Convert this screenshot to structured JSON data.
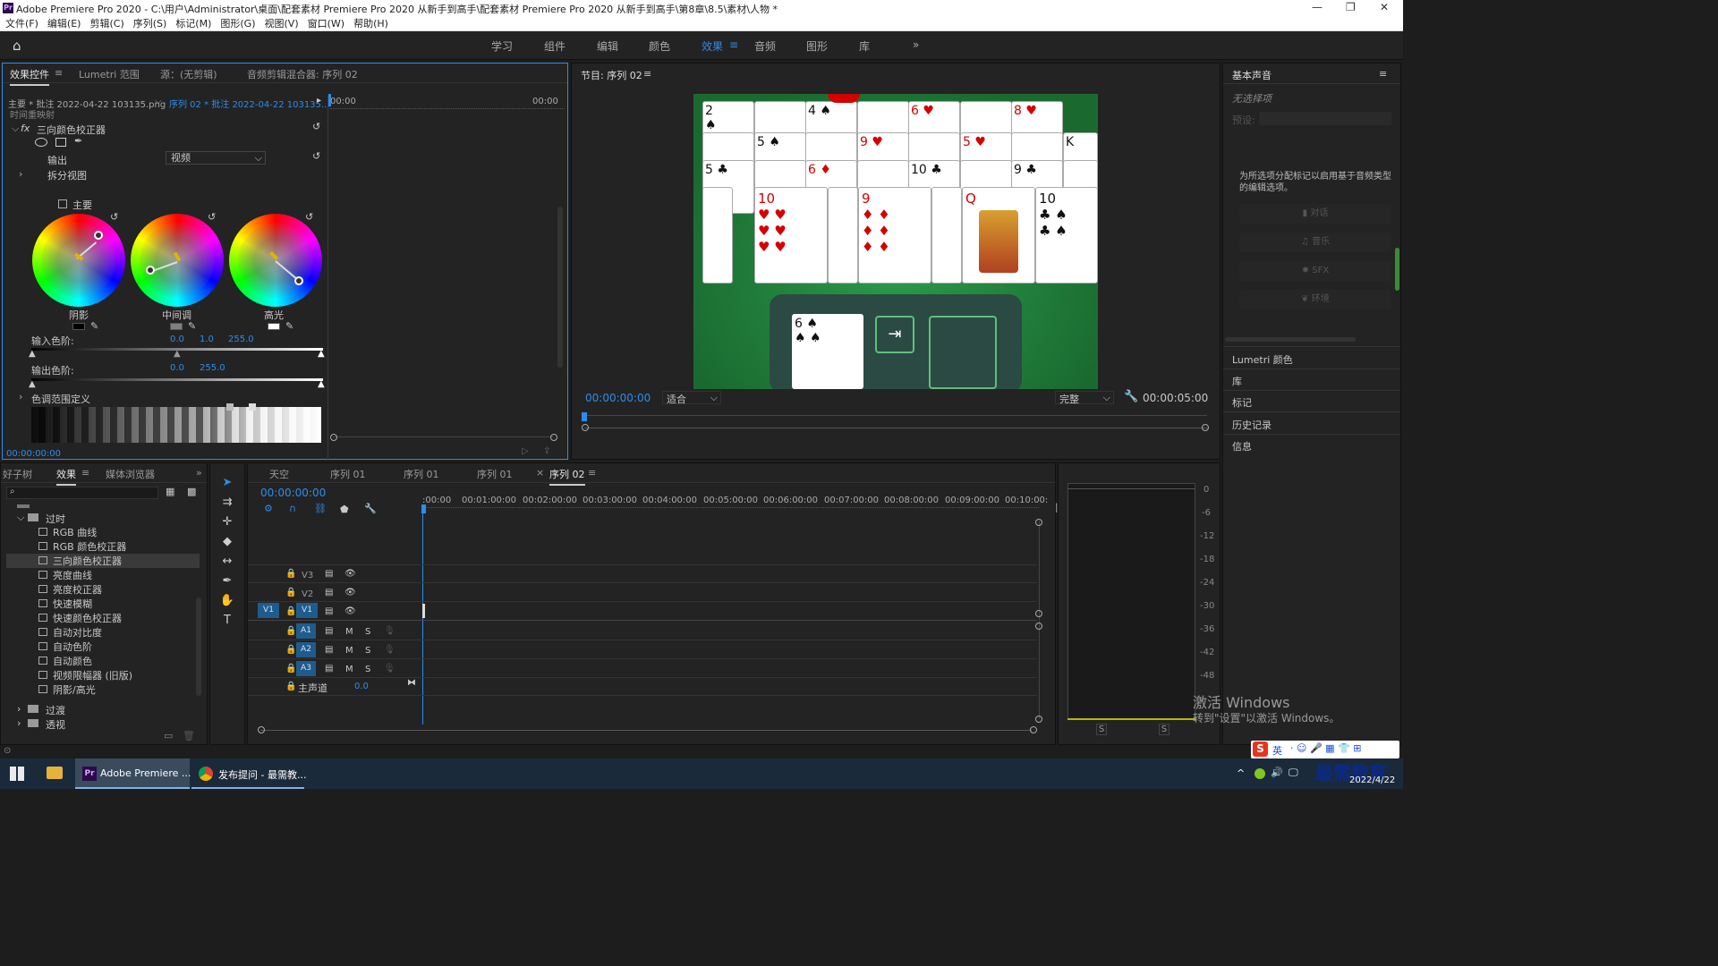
{
  "window": {
    "title": "Adobe Premiere Pro 2020 - C:\\用户\\Administrator\\桌面\\配套素材 Premiere Pro 2020 从新手到高手\\配套素材 Premiere Pro 2020 从新手到高手\\第8章\\8.5\\素材\\人物 *",
    "app_icon": "Pr",
    "minimize": "—",
    "maximize": "❐",
    "close": "✕"
  },
  "menu": [
    "文件(F)",
    "编辑(E)",
    "剪辑(C)",
    "序列(S)",
    "标记(M)",
    "图形(G)",
    "视图(V)",
    "窗口(W)",
    "帮助(H)"
  ],
  "workspaces": [
    "学习",
    "组件",
    "编辑",
    "颜色",
    "效果",
    "音频",
    "图形",
    "库"
  ],
  "workspace_active": "效果",
  "workspace_more": "»",
  "effect_controls": {
    "tabs": [
      "效果控件",
      "Lumetri 范围",
      "源：(无剪辑)",
      "音频剪辑混合器: 序列 02"
    ],
    "source": "主要 * 批注 2022-04-22 103135.png",
    "sequence": "序列 02 * 批注 2022-04-22 103135...",
    "ruler_start": "00:00",
    "ruler_end": "00:00",
    "time_remap": "时间重映射",
    "fx_label": "fx",
    "effect_name": "三向颜色校正器",
    "output_label": "输出",
    "output_value": "视频",
    "split_view": "拆分视图",
    "master_label": "主要",
    "wheels": [
      "阴影",
      "中间调",
      "高光"
    ],
    "input_levels_label": "输入色阶:",
    "input_levels": [
      "0.0",
      "1.0",
      "255.0"
    ],
    "output_levels_label": "输出色阶:",
    "output_levels": [
      "0.0",
      "255.0"
    ],
    "tonal_range": "色调范围定义",
    "timecode": "00:00:00:00"
  },
  "program": {
    "title": "节目: 序列 02",
    "timecode": "00:00:00:00",
    "fit": "适合",
    "quality": "完整",
    "duration": "00:00:05:00",
    "cards_top": [
      "2",
      "4",
      "6",
      "8"
    ],
    "cards_mid": [
      "5",
      "9",
      "5",
      "K"
    ],
    "cards_low": [
      "5",
      "6",
      "10",
      "9"
    ],
    "cards_front": [
      "10",
      "9",
      "Q",
      "10"
    ],
    "stock_card": "6"
  },
  "effects_panel": {
    "tabs": [
      "好子树",
      "效果",
      "媒体浏览器"
    ],
    "folder_open": "过时",
    "items": [
      "RGB 曲线",
      "RGB 颜色校正器",
      "三向颜色校正器",
      "亮度曲线",
      "亮度校正器",
      "快速模糊",
      "快速颜色校正器",
      "自动对比度",
      "自动色阶",
      "自动颜色",
      "视频限幅器 (旧版)",
      "阴影/高光"
    ],
    "selected_item": "三向颜色校正器",
    "folders_after": [
      "过渡",
      "透视"
    ]
  },
  "timeline": {
    "tabs": [
      "天空",
      "序列 01",
      "序列 01",
      "序列 01",
      "序列 02"
    ],
    "active_tab": "序列 02",
    "timecode": "00:00:00:00",
    "ruler": [
      ":00:00",
      "00:01:00:00",
      "00:02:00:00",
      "00:03:00:00",
      "00:04:00:00",
      "00:05:00:00",
      "00:06:00:00",
      "00:07:00:00",
      "00:08:00:00",
      "00:09:00:00",
      "00:10:00:"
    ],
    "video_tracks": [
      "V3",
      "V2",
      "V1"
    ],
    "audio_tracks": [
      "A1",
      "A2",
      "A3"
    ],
    "source_patch": "V1",
    "master": "主声道",
    "master_value": "0.0",
    "mute": "M",
    "solo": "S"
  },
  "meter": {
    "scale": [
      "0",
      "-6",
      "-12",
      "-18",
      "-24",
      "-30",
      "-36",
      "-42",
      "-48"
    ],
    "solo": [
      "S",
      "S"
    ]
  },
  "essential_sound": {
    "title": "基本声音",
    "no_selection": "无选择项",
    "preset_label": "预设:",
    "hint": "为所选项分配标记以启用基于音频类型的编辑选项。",
    "types": [
      "对话",
      "音乐",
      "SFX",
      "环境"
    ]
  },
  "right_panels": [
    "Lumetri 颜色",
    "库",
    "标记",
    "历史记录",
    "信息"
  ],
  "activate": {
    "line1": "激活 Windows",
    "line2": "转到\"设置\"以激活 Windows。"
  },
  "taskbar": {
    "premiere": "Adobe Premiere ...",
    "chrome": "发布提问 - 最需教...",
    "ime": "英",
    "date": "2022/4/22",
    "watermark": "最需教育"
  },
  "colors": {
    "accent": "#2d8ceb",
    "panel": "#232323",
    "felt": "#1f7a3a"
  }
}
